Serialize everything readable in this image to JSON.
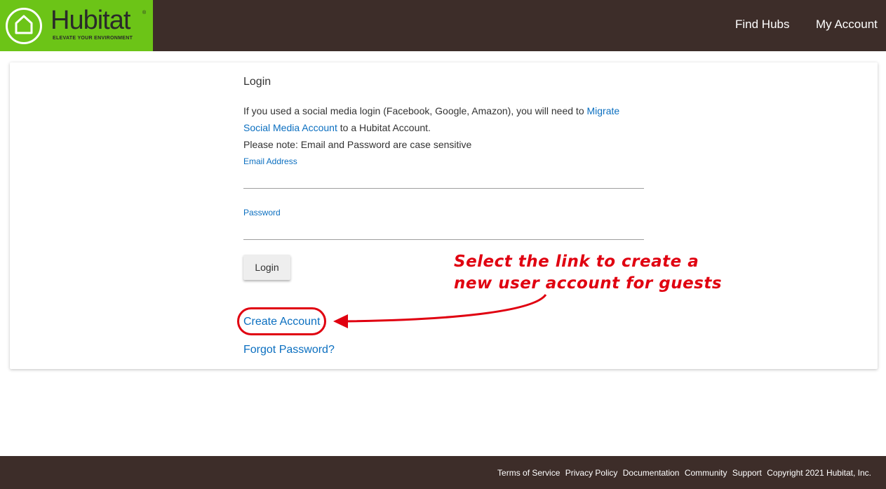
{
  "header": {
    "logo_word": "Hubitat",
    "logo_reg": "®",
    "logo_tagline": "ELEVATE YOUR ENVIRONMENT",
    "nav": {
      "find_hubs": "Find Hubs",
      "my_account": "My Account"
    }
  },
  "login": {
    "title": "Login",
    "info_prefix": "If you used a social media login (Facebook, Google, Amazon), you will need to ",
    "info_link": "Migrate Social Media Account",
    "info_suffix": " to a Hubitat Account.",
    "note": "Please note: Email and Password are case sensitive",
    "email_label": "Email Address",
    "email_value": "",
    "password_label": "Password",
    "password_value": "",
    "login_button": "Login",
    "create_account": "Create Account",
    "forgot_password": "Forgot Password?"
  },
  "annotation": {
    "line1": "Select the link to create a",
    "line2": "new user account for guests",
    "color": "#e00010"
  },
  "footer": {
    "terms": "Terms of Service",
    "privacy": "Privacy Policy",
    "documentation": "Documentation",
    "community": "Community",
    "support": "Support",
    "copyright": "Copyright 2021 Hubitat, Inc."
  },
  "colors": {
    "header_bg": "#3d2d29",
    "logo_green": "#6cc417",
    "link_blue": "#0b6fc0"
  }
}
